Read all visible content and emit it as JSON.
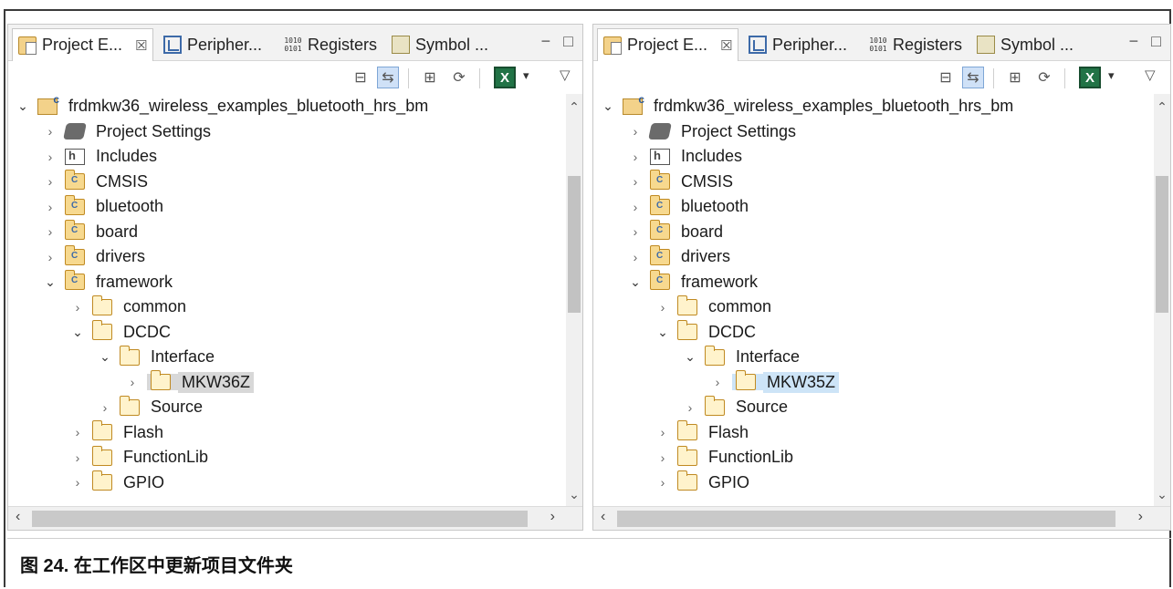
{
  "tabs": [
    "Project E...",
    "Peripher...",
    "Registers",
    "Symbol ..."
  ],
  "tab_close_glyph": "☒",
  "window_controls": {
    "minimize": "−",
    "maximize": "□"
  },
  "toolbar": {
    "excel_label": "X",
    "dropdown_glyph": "▾",
    "view_menu_glyph": "▽"
  },
  "tree": {
    "project_name": "frdmkw36_wireless_examples_bluetooth_hrs_bm",
    "top_items": [
      "Project Settings",
      "Includes",
      "CMSIS",
      "bluetooth",
      "board",
      "drivers",
      "framework"
    ],
    "framework_children": [
      "common",
      "DCDC"
    ],
    "dcdc_children": [
      "Interface"
    ],
    "after_interface": [
      "Source"
    ],
    "after_dcdc": [
      "Flash",
      "FunctionLib",
      "GPIO"
    ]
  },
  "left_panel": {
    "selected_folder": "MKW36Z"
  },
  "right_panel": {
    "selected_folder": "MKW35Z"
  },
  "caption": "图 24. 在工作区中更新项目文件夹",
  "colors": {
    "selection_left": "#d8d8d8",
    "selection_right": "#cde4f7",
    "excel_green": "#217346"
  }
}
